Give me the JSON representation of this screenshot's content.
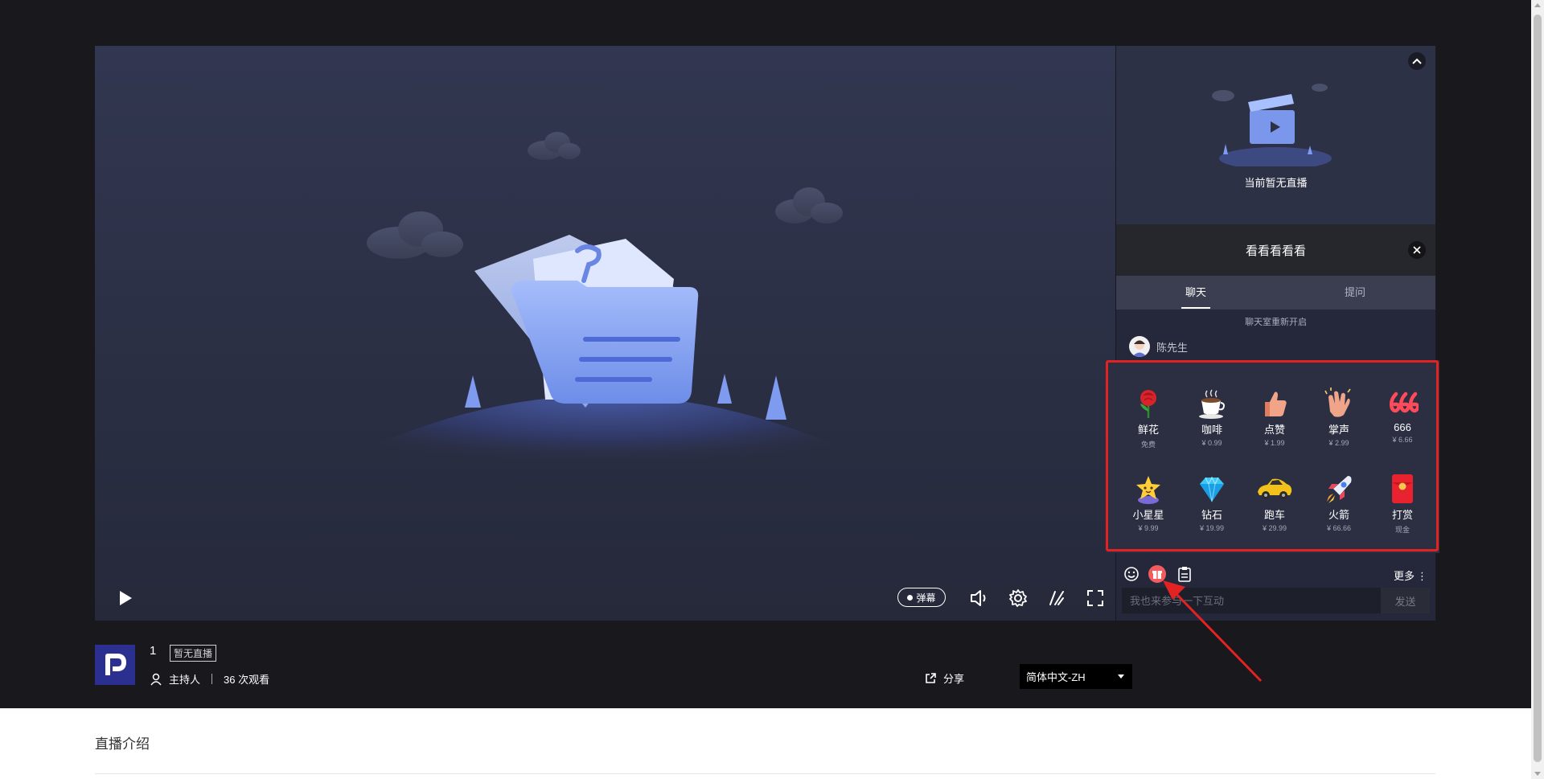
{
  "player": {
    "danmu_label": "弹幕"
  },
  "side": {
    "no_live_text": "当前暂无直播",
    "chat_title": "看看看看看",
    "tabs": [
      {
        "label": "聊天",
        "active": true
      },
      {
        "label": "提问",
        "active": false
      }
    ],
    "notice": "聊天室重新开启",
    "message_user": "陈先生"
  },
  "gifts": [
    {
      "name": "鲜花",
      "price": "免费",
      "icon": "rose-icon"
    },
    {
      "name": "咖啡",
      "price": "¥ 0.99",
      "icon": "coffee-icon"
    },
    {
      "name": "点赞",
      "price": "¥ 1.99",
      "icon": "thumbs-up-icon"
    },
    {
      "name": "掌声",
      "price": "¥ 2.99",
      "icon": "clap-icon"
    },
    {
      "name": "666",
      "price": "¥ 6.66",
      "icon": "666-icon"
    },
    {
      "name": "小星星",
      "price": "¥ 9.99",
      "icon": "star-icon"
    },
    {
      "name": "钻石",
      "price": "¥ 19.99",
      "icon": "diamond-icon"
    },
    {
      "name": "跑车",
      "price": "¥ 29.99",
      "icon": "sports-car-icon"
    },
    {
      "name": "火箭",
      "price": "¥ 66.66",
      "icon": "rocket-icon"
    },
    {
      "name": "打赏",
      "price": "现金",
      "icon": "red-envelope-icon"
    }
  ],
  "toolbar": {
    "more_label": "更多"
  },
  "chat_input": {
    "placeholder": "我也来参与一下互动",
    "send_label": "发送"
  },
  "room": {
    "title": "1",
    "status": "暂无直播",
    "host_label": "主持人",
    "views": "36 次观看",
    "share_label": "分享",
    "language": "简体中文-ZH"
  },
  "intro": {
    "title": "直播介绍"
  },
  "colors": {
    "annotation_red": "#e32222",
    "gift_button": "#f25c5c",
    "logo_bg": "#2b2f8f"
  }
}
